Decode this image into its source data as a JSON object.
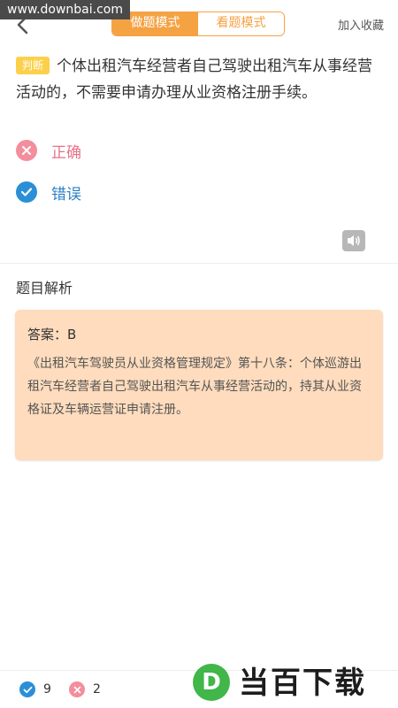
{
  "watermark_url": "www.downbai.com",
  "header": {
    "modes": [
      "做题模式",
      "看题模式"
    ],
    "active_mode": "做题模式",
    "favorite_label": "加入收藏"
  },
  "question": {
    "type_badge": "判断",
    "text": "个体出租汽车经营者自己驾驶出租汽车从事经营活动的，不需要申请办理从业资格注册手续。"
  },
  "options": [
    {
      "label": "正确",
      "state": "wrong",
      "icon": "x-icon"
    },
    {
      "label": "错误",
      "state": "correct",
      "icon": "check-icon"
    }
  ],
  "analysis": {
    "title": "题目解析",
    "answer": "答案：B",
    "text": "《出租汽车驾驶员从业资格管理规定》第十八条：个体巡游出租汽车经营者自己驾驶出租汽车从事经营活动的，持其从业资格证及车辆运营证申请注册。"
  },
  "stats": {
    "correct_count": "9",
    "wrong_count": "2"
  },
  "brand": {
    "mark": "D",
    "name": "当百下载"
  },
  "colors": {
    "accent": "#f5a243",
    "correct": "#2a8fd6",
    "wrong": "#f38e9d",
    "analysis_bg": "#fedcbd"
  }
}
